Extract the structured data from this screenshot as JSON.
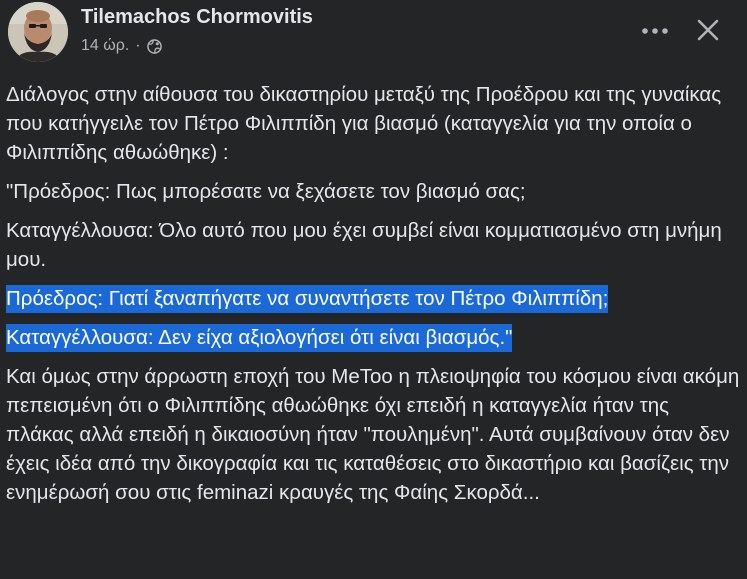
{
  "post": {
    "author_name": "Tilemachos Chormovitis",
    "timestamp": "14 ώρ.",
    "separator": "·",
    "audience_icon": "globe-icon",
    "more_icon": "more-dots-icon",
    "close_icon": "close-icon"
  },
  "body": {
    "paragraph_1": "Διάλογος στην αίθουσα του δικαστηρίου μεταξύ της Προέδρου και της γυναίκας που κατήγγειλε τον Πέτρο Φιλιππίδη για βιασμό (καταγγελία για την οποία ο Φιλιππίδης αθωώθηκε) :",
    "paragraph_2": "\"Πρόεδρος: Πως μπορέσατε να ξεχάσετε τον βιασμό σας;",
    "paragraph_3": "Καταγγέλλουσα: Όλο αυτό που μου έχει συμβεί είναι κομματιασμένο στη μνήμη μου.",
    "paragraph_4": "Πρόεδρος: Γιατί ξαναπήγατε να συναντήσετε τον Πέτρο Φιλιππίδη;",
    "paragraph_5": "Καταγγέλλουσα: Δεν είχα αξιολογήσει ότι είναι βιασμός.\"",
    "paragraph_6": "Και όμως στην άρρωστη εποχή του MeToo η πλειοψηφία του κόσμου είναι ακόμη πεπεισμένη ότι ο Φιλιππίδης αθωώθηκε όχι επειδή η καταγγελία ήταν της πλάκας αλλά επειδή η δικαιοσύνη ήταν \"πουλημένη\". Αυτά συμβαίνουν όταν δεν έχεις ιδέα από την δικογραφία και τις καταθέσεις στο δικαστήριο και βασίζεις την ενημέρωσή σου στις feminazi κραυγές της Φαίης Σκορδά..."
  },
  "colors": {
    "background": "#242526",
    "text_primary": "#e4e6eb",
    "text_secondary": "#b0b3b8",
    "selection_highlight": "#1a69d6"
  }
}
